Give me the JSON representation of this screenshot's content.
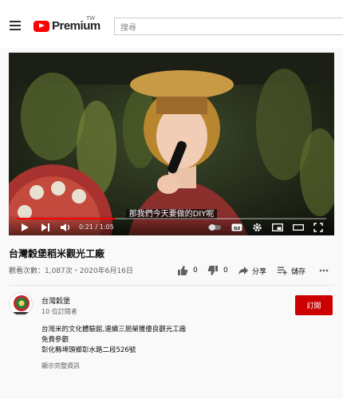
{
  "header": {
    "logo_text": "Premium",
    "region": "TW",
    "search_placeholder": "搜尋"
  },
  "player": {
    "subtitle": "那我們今天要做的DIY呢",
    "current_time": "0:21",
    "duration": "1:05",
    "time_separator": " / ",
    "progress": 0.32
  },
  "video": {
    "title": "台灣穀堡稻米觀光工廠",
    "views": "觀看次數：1,087次",
    "date": "2020年6月16日",
    "meta_separator": "・",
    "likes": "0",
    "dislikes": "0",
    "share_label": "分享",
    "save_label": "儲存"
  },
  "channel": {
    "name": "台灣穀堡",
    "subscribers": "10 位訂閱者",
    "subscribe_label": "訂閱",
    "avatar_caption": "台灣穀堡"
  },
  "description": {
    "lines": [
      "台灣米的文化體驗館,連續三屆榮獲優良觀光工廠",
      "免費參觀",
      "彰化縣埤頭鄉彰水路二段526號"
    ],
    "show_more": "顯示完整資訊"
  },
  "colors": {
    "brand_red": "#ff0000",
    "subscribe_red": "#cc0000"
  }
}
